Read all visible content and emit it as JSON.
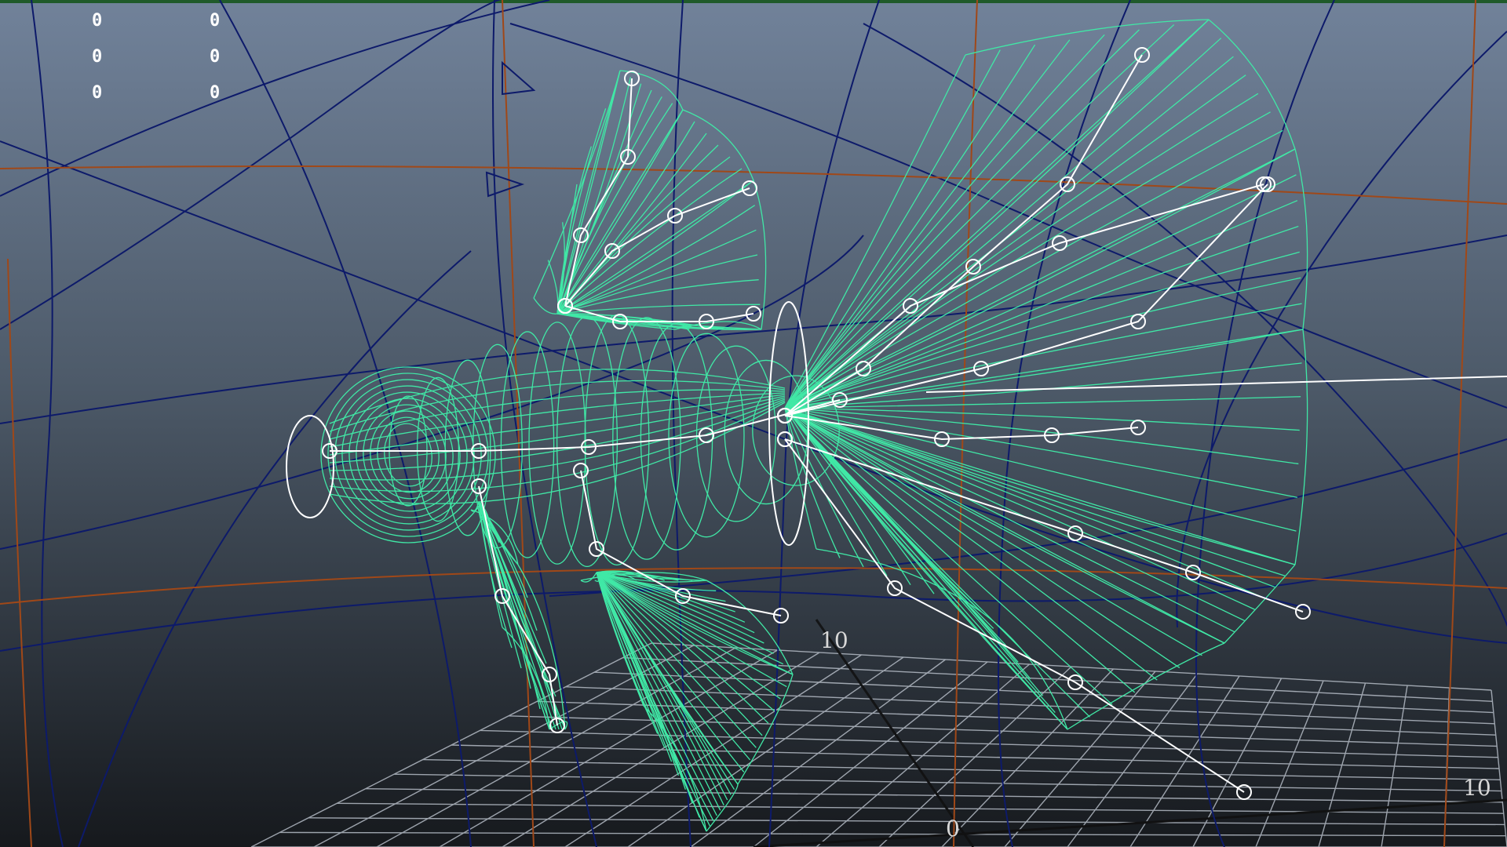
{
  "viewport": {
    "name": "perspective-viewport",
    "border_color": "#1f5a2a",
    "background_top": "#6f7f92",
    "background_bottom": "#15181c"
  },
  "hud": {
    "column_a": [
      "0",
      "0",
      "0"
    ],
    "column_b": [
      "0",
      "0",
      "0"
    ]
  },
  "grid_labels": {
    "near": "0",
    "mid": "10",
    "right": "10"
  },
  "colors": {
    "mesh": "#40e8a6",
    "joints": "#ffffff",
    "lattice": "#0d1a6a",
    "lattice_accent": "#a04818",
    "ground_grid": "#b5bcc6"
  }
}
